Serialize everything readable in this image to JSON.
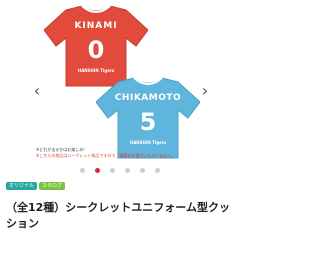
{
  "gallery": {
    "prev_arrow": "‹",
    "next_arrow": "›",
    "jersey_red": {
      "name": "KINAMI",
      "number": "0",
      "team": "HANSHIN Tigers",
      "color": "#e24b3b"
    },
    "jersey_blue": {
      "name": "CHIKAMOTO",
      "number": "5",
      "team": "HANSHIN Tigers",
      "color": "#5fb5dc"
    },
    "notice_line1": "※どれが出るかはお楽しみ!",
    "notice_line2": "※こちらの商品はシークレット商品ですので、種類をお選びいただけません。",
    "dots_count": 6,
    "active_dot": 1
  },
  "badges": {
    "original": "オリジナル",
    "catalog": "カタログ"
  },
  "product": {
    "title": "（全12種）シークレットユニフォーム型クッション"
  }
}
